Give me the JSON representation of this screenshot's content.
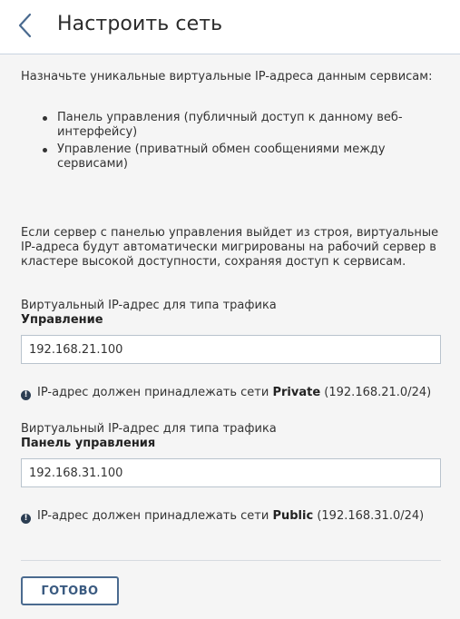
{
  "header": {
    "title": "Настроить сеть",
    "back_icon": "chevron-left-icon"
  },
  "intro": "Назначьте уникальные виртуальные IP-адреса данным сервисам:",
  "bullets": [
    "Панель управления (публичный доступ к данному веб-интерфейсу)",
    "Управление (приватный обмен сообщениями между сервисами)"
  ],
  "failover_text": "Если сервер с панелью управления выйдет из строя, виртуальные IP-адреса будут автоматически мигрированы на рабочий сервер в кластере высокой доступности, сохраняя доступ к сервисам.",
  "fields": [
    {
      "label_prefix": "Виртуальный IP-адрес для типа трафика",
      "label_bold": "Управление",
      "value": "192.168.21.100",
      "hint_prefix": "IP-адрес должен принадлежать сети",
      "hint_network": "Private",
      "hint_subnet": "(192.168.21.0/24)"
    },
    {
      "label_prefix": "Виртуальный IP-адрес для типа трафика",
      "label_bold": "Панель управления",
      "value": "192.168.31.100",
      "hint_prefix": "IP-адрес должен принадлежать сети",
      "hint_network": "Public",
      "hint_subnet": "(192.168.31.0/24)"
    }
  ],
  "hint_icon": "exclamation-circle-icon",
  "hint_icon_glyph": "!",
  "done_label": "ГОТОВО",
  "colors": {
    "accent": "#4a6a8f",
    "header_border": "#c9d4e0",
    "background": "#f5f5f5"
  }
}
